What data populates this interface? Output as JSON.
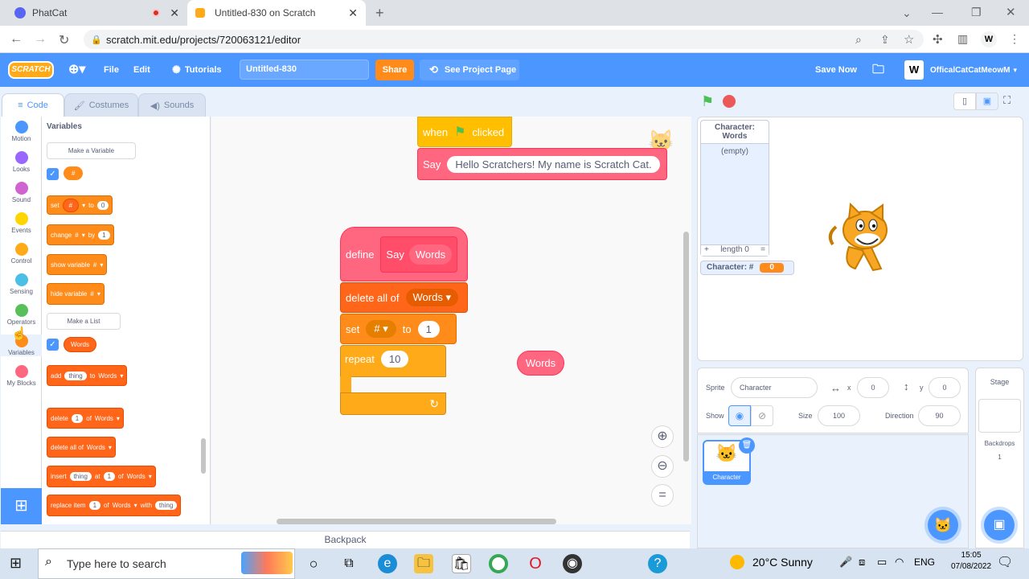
{
  "browser": {
    "tabs": [
      {
        "label": "PhatCat"
      },
      {
        "label": "Untitled-830 on Scratch"
      }
    ],
    "url": "scratch.mit.edu/projects/720063121/editor",
    "profile_initial": "W"
  },
  "menubar": {
    "logo": "SCRATCH",
    "file": "File",
    "edit": "Edit",
    "tutorials": "Tutorials",
    "project_title": "Untitled-830",
    "share": "Share",
    "see_project": "See Project Page",
    "save_now": "Save Now",
    "username": "OfficalCatCatMeowM"
  },
  "editor_tabs": [
    "Code",
    "Costumes",
    "Sounds"
  ],
  "categories": [
    {
      "label": "Motion",
      "color": "#4c97ff"
    },
    {
      "label": "Looks",
      "color": "#9966ff"
    },
    {
      "label": "Sound",
      "color": "#cf63cf"
    },
    {
      "label": "Events",
      "color": "#ffd500"
    },
    {
      "label": "Control",
      "color": "#ffab19"
    },
    {
      "label": "Sensing",
      "color": "#4cbfe6"
    },
    {
      "label": "Operators",
      "color": "#59c059"
    },
    {
      "label": "Variables",
      "color": "#ff8c1a"
    },
    {
      "label": "My Blocks",
      "color": "#ff6680"
    }
  ],
  "palette": {
    "heading": "Variables",
    "make_variable": "Make a Variable",
    "var_name": "#",
    "set": {
      "w1": "set",
      "var": "#",
      "w2": "to",
      "val": "0"
    },
    "change": {
      "w1": "change",
      "var": "#",
      "w2": "by",
      "val": "1"
    },
    "show": {
      "w1": "show variable",
      "var": "#"
    },
    "hide": {
      "w1": "hide variable",
      "var": "#"
    },
    "make_list": "Make a List",
    "list_name": "Words",
    "add": {
      "w1": "add",
      "thing": "thing",
      "w2": "to",
      "list": "Words"
    },
    "delete": {
      "w1": "delete",
      "n": "1",
      "w2": "of",
      "list": "Words"
    },
    "delete_all": {
      "w1": "delete all of",
      "list": "Words"
    },
    "insert": {
      "w1": "insert",
      "thing": "thing",
      "w2": "at",
      "n": "1",
      "w3": "of",
      "list": "Words"
    },
    "replace": {
      "w1": "replace item",
      "n": "1",
      "w2": "of",
      "list": "Words",
      "w3": "with",
      "thing": "thing"
    }
  },
  "workspace": {
    "when": "when",
    "clicked": "clicked",
    "say": "Say",
    "say_text": "Hello Scratchers! My name is Scratch Cat.",
    "define": "define",
    "define_name": "Say",
    "define_param": "Words",
    "delete_all": "delete all of",
    "delete_list": "Words",
    "set": "set",
    "set_var": "#",
    "set_to": "to",
    "set_val": "1",
    "repeat": "repeat",
    "repeat_val": "10",
    "loose_reporter": "Words"
  },
  "backpack": "Backpack",
  "stage": {
    "list_title": "Character: Words",
    "list_empty": "(empty)",
    "list_plus": "+",
    "list_length": "length 0",
    "list_eq": "=",
    "var_label": "Character: #",
    "var_value": "0"
  },
  "sprite_info": {
    "sprite_label": "Sprite",
    "sprite_name": "Character",
    "x_label": "x",
    "x_val": "0",
    "y_label": "y",
    "y_val": "0",
    "show_label": "Show",
    "size_label": "Size",
    "size_val": "100",
    "direction_label": "Direction",
    "direction_val": "90",
    "thumb_name": "Character"
  },
  "stage_panel": {
    "title": "Stage",
    "backdrops": "Backdrops",
    "count": "1"
  },
  "taskbar": {
    "search": "Type here to search",
    "weather": "20°C  Sunny",
    "lang": "ENG",
    "time": "15:05",
    "date": "07/08/2022"
  }
}
